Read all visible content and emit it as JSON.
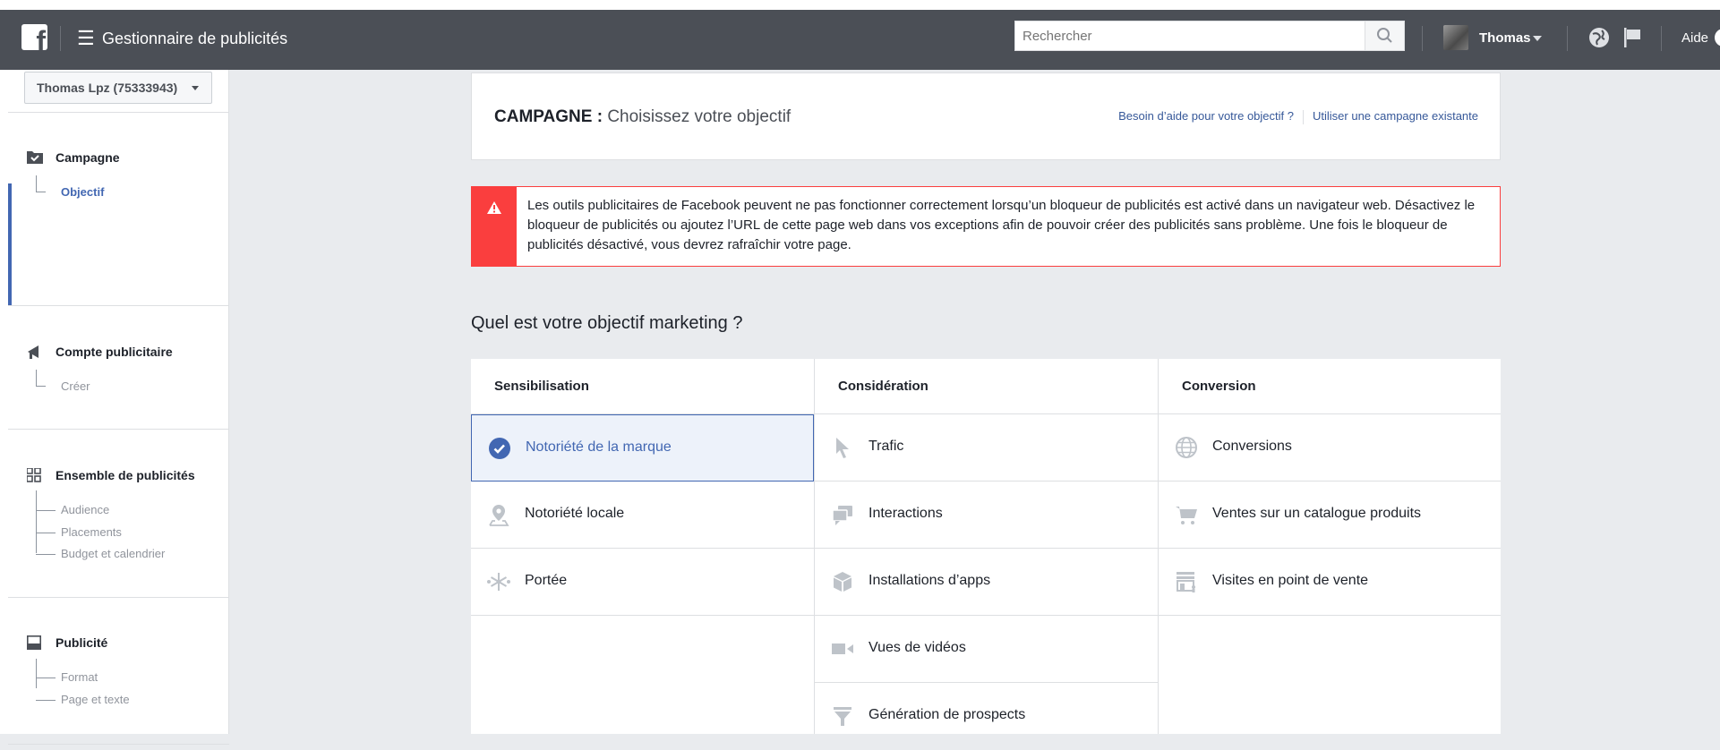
{
  "topbar": {
    "app_title": "Gestionnaire de publicités",
    "search_placeholder": "Rechercher",
    "user_name": "Thomas",
    "help_label": "Aide",
    "brand_color": "#4b4f56"
  },
  "sidebar": {
    "account_selector": "Thomas Lpz (75333943)",
    "sections": [
      {
        "label": "Campagne",
        "icon": "folder-check-icon",
        "items": [
          "Objectif"
        ],
        "active_item": "Objectif"
      },
      {
        "label": "Compte publicitaire",
        "icon": "megaphone-icon",
        "items": [
          "Créer"
        ]
      },
      {
        "label": "Ensemble de publicités",
        "icon": "grid-icon",
        "items": [
          "Audience",
          "Placements",
          "Budget et calendrier"
        ]
      },
      {
        "label": "Publicité",
        "icon": "ad-icon",
        "items": [
          "Format",
          "Page et texte"
        ]
      }
    ]
  },
  "header": {
    "title_prefix": "CAMPAGNE :",
    "title_text": "Choisissez votre objectif",
    "help_link": "Besoin d’aide pour votre objectif ?",
    "existing_link": "Utiliser une campagne existante"
  },
  "alert": {
    "text": "Les outils publicitaires de Facebook peuvent ne pas fonctionner correctement lorsqu’un bloqueur de publicités est activé dans un navigateur web. Désactivez le bloqueur de publicités ou ajoutez l’URL de cette page web dans vos exceptions afin de pouvoir créer des publicités sans problème. Une fois le bloqueur de publicités désactivé, vous devrez rafraîchir votre page.",
    "color": "#fa3e3e"
  },
  "question": "Quel est votre objectif marketing ?",
  "objectives": {
    "columns": [
      {
        "header": "Sensibilisation",
        "items": [
          "Notoriété de la marque",
          "Notoriété locale",
          "Portée"
        ]
      },
      {
        "header": "Considération",
        "items": [
          "Trafic",
          "Interactions",
          "Installations d’apps",
          "Vues de vidéos",
          "Génération de prospects"
        ]
      },
      {
        "header": "Conversion",
        "items": [
          "Conversions",
          "Ventes sur un catalogue produits",
          "Visites en point de vente"
        ]
      }
    ],
    "selected": "Notoriété de la marque",
    "accent_color": "#4267b2"
  }
}
